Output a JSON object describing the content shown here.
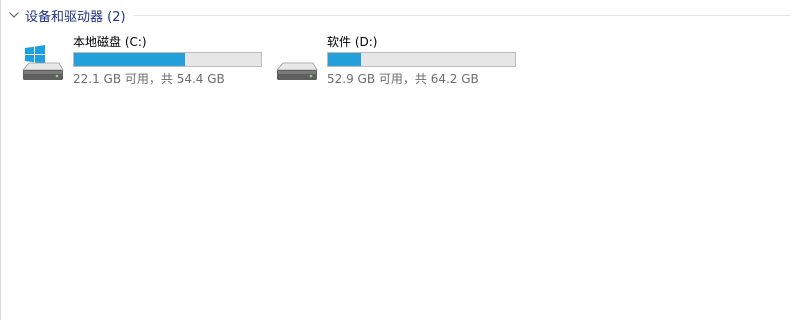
{
  "group": {
    "title": "设备和驱动器 (2)",
    "icon": "chevron-down-icon"
  },
  "drives": [
    {
      "name": "本地磁盘 (C:)",
      "space_text": "22.1 GB 可用，共 54.4 GB",
      "used_fraction": 0.594,
      "icon": "system-drive-icon",
      "bar_color": "#26a0da"
    },
    {
      "name": "软件 (D:)",
      "space_text": "52.9 GB 可用，共 64.2 GB",
      "used_fraction": 0.176,
      "icon": "hard-drive-icon",
      "bar_color": "#26a0da"
    }
  ]
}
